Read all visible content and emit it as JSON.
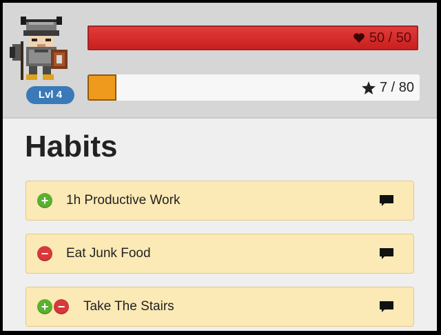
{
  "header": {
    "level_badge": "Lvl 4",
    "hp": {
      "text": "50 / 50",
      "current": 50,
      "max": 50,
      "icon": "heart-icon"
    },
    "xp": {
      "text": "7 / 80",
      "current": 7,
      "max": 80,
      "icon": "star-icon"
    }
  },
  "main": {
    "title": "Habits",
    "habits": [
      {
        "label": "1h Productive Work",
        "buttons": [
          "plus"
        ]
      },
      {
        "label": "Eat Junk Food",
        "buttons": [
          "minus"
        ]
      },
      {
        "label": "Take The Stairs",
        "buttons": [
          "plus",
          "minus"
        ]
      }
    ]
  },
  "colors": {
    "hp_fill": "#d42a2a",
    "xp_fill": "#f09a1d",
    "habit_bg": "#fbe9b6",
    "plus": "#5bb12f",
    "minus": "#d8383a",
    "badge": "#3a7ab8"
  }
}
